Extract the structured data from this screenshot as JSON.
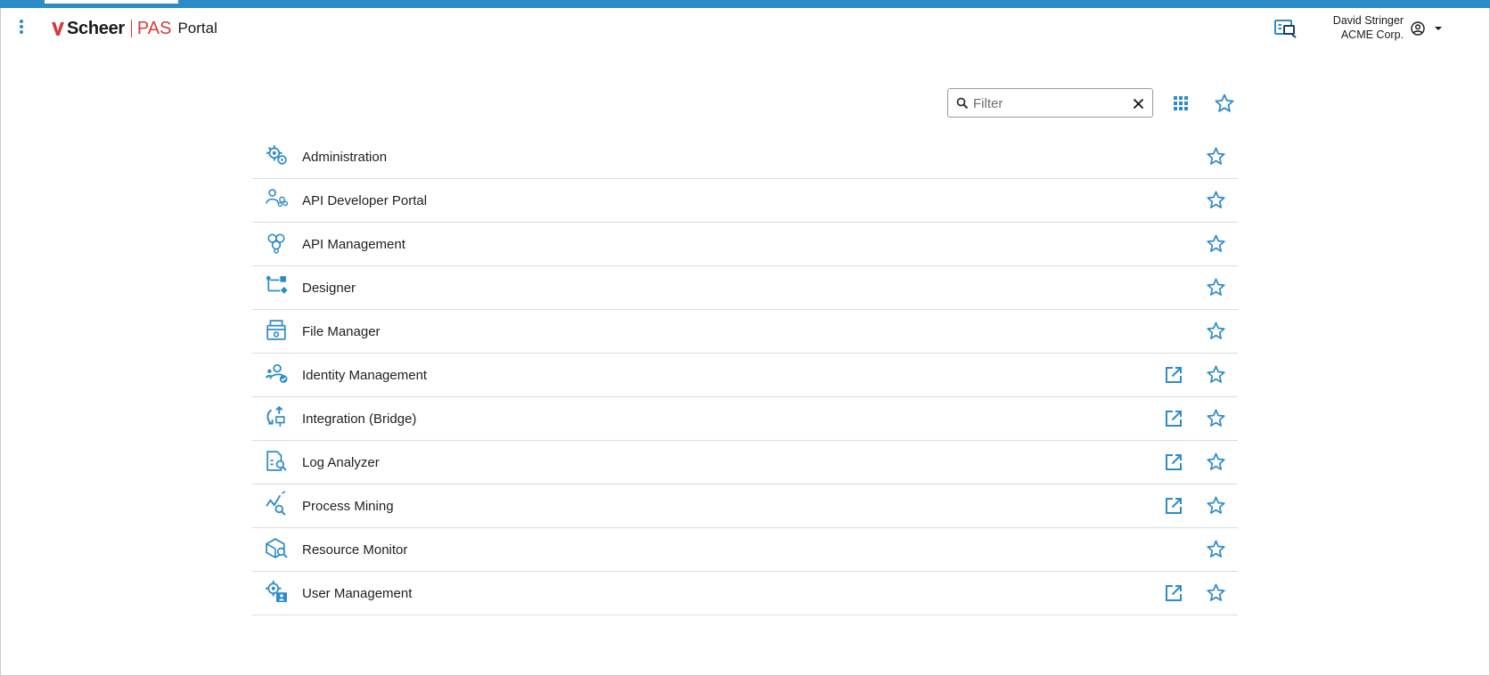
{
  "header": {
    "brand_name": "Scheer",
    "brand_product": "PAS",
    "brand_suffix": "Portal",
    "menu_icon": "more-vert-icon",
    "notification_icon": "message-center-icon",
    "user_name": "David Stringer",
    "user_org": "ACME Corp.",
    "user_icon": "account-circle-icon",
    "user_menu_icon": "caret-down-icon"
  },
  "toolbar": {
    "filter_placeholder": "Filter",
    "filter_value": "",
    "search_icon": "search-icon",
    "clear_icon": "close-icon",
    "grid_view_icon": "grid-view-icon",
    "favorites_icon": "star-outline-icon"
  },
  "apps": [
    {
      "label": "Administration",
      "icon": "admin-gear-icon",
      "external": false,
      "favorite": false
    },
    {
      "label": "API Developer Portal",
      "icon": "api-developer-icon",
      "external": false,
      "favorite": false
    },
    {
      "label": "API Management",
      "icon": "api-management-icon",
      "external": false,
      "favorite": false
    },
    {
      "label": "Designer",
      "icon": "designer-flow-icon",
      "external": false,
      "favorite": false
    },
    {
      "label": "File Manager",
      "icon": "file-manager-icon",
      "external": false,
      "favorite": false
    },
    {
      "label": "Identity Management",
      "icon": "identity-icon",
      "external": true,
      "favorite": false
    },
    {
      "label": "Integration (Bridge)",
      "icon": "integration-icon",
      "external": true,
      "favorite": false
    },
    {
      "label": "Log Analyzer",
      "icon": "log-analyzer-icon",
      "external": true,
      "favorite": false
    },
    {
      "label": "Process Mining",
      "icon": "process-mining-icon",
      "external": true,
      "favorite": false
    },
    {
      "label": "Resource Monitor",
      "icon": "resource-monitor-icon",
      "external": false,
      "favorite": false
    },
    {
      "label": "User Management",
      "icon": "user-management-icon",
      "external": true,
      "favorite": false
    }
  ],
  "colors": {
    "accent": "#2e8bc9",
    "brand_red": "#d83a35",
    "text": "#1f1f1f",
    "divider": "#dcdcdc"
  }
}
